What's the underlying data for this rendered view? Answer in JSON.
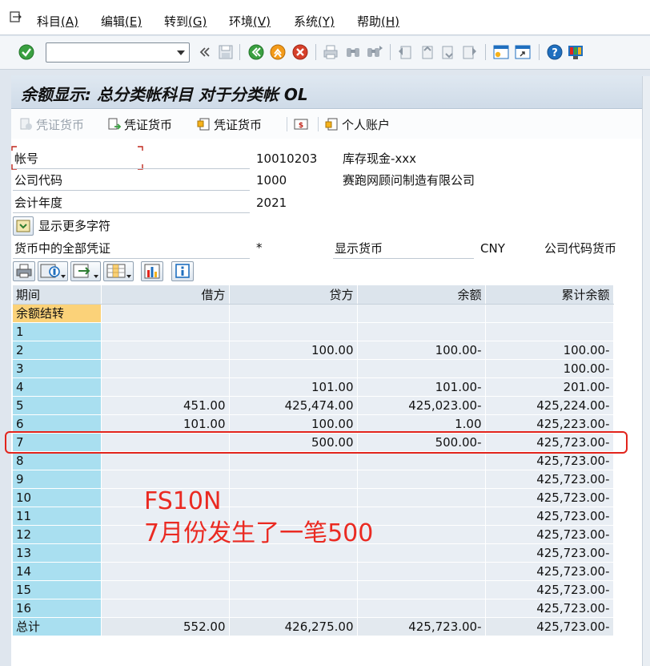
{
  "menu": {
    "items": [
      {
        "label": "科目",
        "mnemonic": "(A)"
      },
      {
        "label": "编辑",
        "mnemonic": "(E)"
      },
      {
        "label": "转到",
        "mnemonic": "(G)"
      },
      {
        "label": "环境",
        "mnemonic": "(V)"
      },
      {
        "label": "系统",
        "mnemonic": "(Y)"
      },
      {
        "label": "帮助",
        "mnemonic": "(H)"
      }
    ]
  },
  "toolbar": {
    "command_value": "",
    "icons": [
      "enter-icon",
      "back-chevrons-icon",
      "save-icon",
      "back-icon",
      "exit-icon",
      "cancel-icon",
      "print-icon",
      "find-icon",
      "find-next-icon",
      "first-page-icon",
      "previous-page-icon",
      "next-page-icon",
      "last-page-icon",
      "create-session-icon",
      "shortcut-icon",
      "help-icon",
      "customize-layout-icon"
    ],
    "colors": {
      "green": "#3aa041",
      "orange": "#f39b1a",
      "red": "#d6402a",
      "blue": "#1f6fbf"
    }
  },
  "title": "余额显示: 总分类帐科目 对于分类帐 OL",
  "app_toolbar": {
    "btn1": "凭证货币",
    "btn2": "凭证货币",
    "btn3": "凭证货币",
    "btn4": "个人账户"
  },
  "header": {
    "account_label": "帐号",
    "account_value": "10010203",
    "account_desc": "库存现金-xxx",
    "company_label": "公司代码",
    "company_value": "1000",
    "company_desc": "赛跑网顾问制造有限公司",
    "year_label": "会计年度",
    "year_value": "2021",
    "more_fields": "显示更多字符",
    "docs_label": "货币中的全部凭证",
    "docs_value": "*",
    "display_currency_label": "显示货币",
    "display_currency_value": "CNY",
    "company_currency_label": "公司代码货币"
  },
  "grid": {
    "columns": [
      "期间",
      "借方",
      "贷方",
      "余额",
      "累计余额"
    ],
    "rows": [
      {
        "period": "余额结转",
        "debit": "",
        "credit": "",
        "balance": "",
        "cumulative": ""
      },
      {
        "period": "1",
        "debit": "",
        "credit": "",
        "balance": "",
        "cumulative": ""
      },
      {
        "period": "2",
        "debit": "",
        "credit": "100.00",
        "balance": "100.00-",
        "cumulative": "100.00-"
      },
      {
        "period": "3",
        "debit": "",
        "credit": "",
        "balance": "",
        "cumulative": "100.00-"
      },
      {
        "period": "4",
        "debit": "",
        "credit": "101.00",
        "balance": "101.00-",
        "cumulative": "201.00-"
      },
      {
        "period": "5",
        "debit": "451.00",
        "credit": "425,474.00",
        "balance": "425,023.00-",
        "cumulative": "425,224.00-"
      },
      {
        "period": "6",
        "debit": "101.00",
        "credit": "100.00",
        "balance": "1.00",
        "cumulative": "425,223.00-"
      },
      {
        "period": "7",
        "debit": "",
        "credit": "500.00",
        "balance": "500.00-",
        "cumulative": "425,723.00-"
      },
      {
        "period": "8",
        "debit": "",
        "credit": "",
        "balance": "",
        "cumulative": "425,723.00-"
      },
      {
        "period": "9",
        "debit": "",
        "credit": "",
        "balance": "",
        "cumulative": "425,723.00-"
      },
      {
        "period": "10",
        "debit": "",
        "credit": "",
        "balance": "",
        "cumulative": "425,723.00-"
      },
      {
        "period": "11",
        "debit": "",
        "credit": "",
        "balance": "",
        "cumulative": "425,723.00-"
      },
      {
        "period": "12",
        "debit": "",
        "credit": "",
        "balance": "",
        "cumulative": "425,723.00-"
      },
      {
        "period": "13",
        "debit": "",
        "credit": "",
        "balance": "",
        "cumulative": "425,723.00-"
      },
      {
        "period": "14",
        "debit": "",
        "credit": "",
        "balance": "",
        "cumulative": "425,723.00-"
      },
      {
        "period": "15",
        "debit": "",
        "credit": "",
        "balance": "",
        "cumulative": "425,723.00-"
      },
      {
        "period": "16",
        "debit": "",
        "credit": "",
        "balance": "",
        "cumulative": "425,723.00-"
      },
      {
        "period": "总计",
        "debit": "552.00",
        "credit": "426,275.00",
        "balance": "425,723.00-",
        "cumulative": "425,723.00-"
      }
    ]
  },
  "annotation": {
    "line1": "FS10N",
    "line2": "7月份发生了一笔500",
    "color": "#ea2a22"
  }
}
